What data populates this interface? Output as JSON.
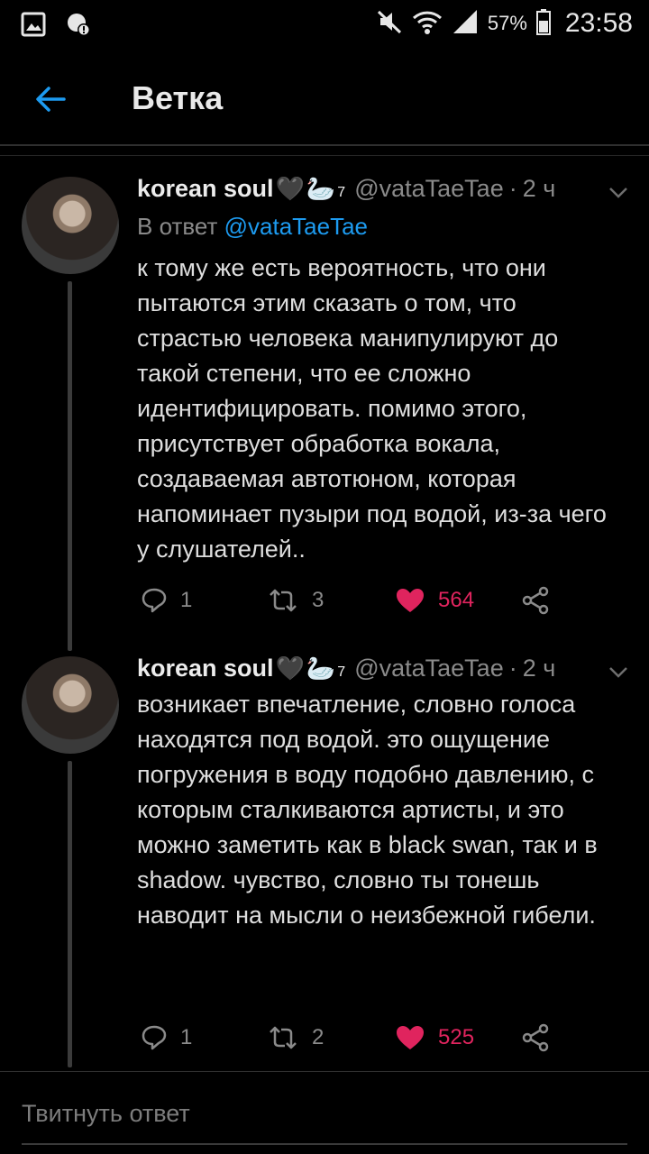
{
  "status_bar": {
    "battery_percent": "57%",
    "time": "23:58",
    "icons": [
      "gallery-icon",
      "alert-icon",
      "mute-icon",
      "wifi-icon",
      "signal-icon",
      "battery-icon"
    ]
  },
  "header": {
    "title": "Ветка",
    "back_icon": "arrow-left-icon"
  },
  "colors": {
    "background": "#000000",
    "accent": "#1d9bf0",
    "like": "#e0245e",
    "muted_text": "#8a8a8a"
  },
  "tweets": [
    {
      "name": "korean soul",
      "heart": "🖤",
      "swan": "🦢",
      "sup": "7",
      "handle": "@vataTaeTae",
      "dot": "·",
      "time": "2 ч",
      "reply_prefix": "В ответ",
      "reply_mention": "@vataTaeTae",
      "text": "к тому же есть вероятность, что они пытаются этим сказать о том, что страстью человека манипулируют до такой степени, что ее сложно идентифицировать. помимо этого, присутствует обработка вокала, создаваемая автотюном, которая напоминает пузыри под водой, из-за чего у слушателей..",
      "replies": "1",
      "retweets": "3",
      "likes": "564"
    },
    {
      "name": "korean soul",
      "heart": "🖤",
      "swan": "🦢",
      "sup": "7",
      "handle": "@vataTaeTae",
      "dot": "·",
      "time": "2 ч",
      "text": "возникает впечатление, словно голоса находятся под водой. это ощущение погружения в воду подобно давлению, с которым сталкиваются артисты, и это можно заметить как в black swan, так и в shadow. чувство, словно ты тонешь наводит на мысли о неизбежной гибели.",
      "replies": "1",
      "retweets": "2",
      "likes": "525"
    }
  ],
  "composer": {
    "placeholder": "Твитнуть ответ"
  }
}
